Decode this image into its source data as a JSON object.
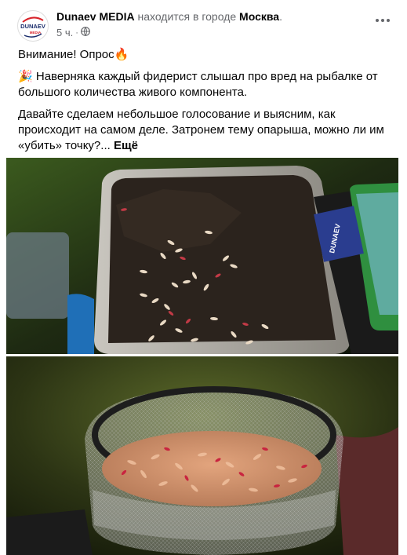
{
  "post": {
    "page_name": "Dunaev MEDIA",
    "location_prefix": "находится в городе",
    "city": "Москва",
    "location_suffix": ".",
    "time": "5 ч.",
    "time_separator": "·",
    "privacy_icon": "globe-icon",
    "more_icon": "more-options-icon",
    "avatar_logo_top": "DUNAEV",
    "avatar_logo_bottom": "MEDIA",
    "headline": "Внимание! Опрос",
    "headline_emoji": "🔥",
    "para1_emoji": "🎉",
    "para1": "Наверняка каждый фидерист слышал про вред на рыбалке от большого количества живого компонента.",
    "para2": "Давайте сделаем небольшое голосование и выясним, как происходит на самом деле. Затронем тему опарыша, можно ли им «убить» точку?...",
    "see_more": "Ещё",
    "photo1_box_label": "DUNAEV"
  },
  "colors": {
    "accent": "#1877f2",
    "secondary_text": "#65676b",
    "logo_red": "#d8232a"
  }
}
